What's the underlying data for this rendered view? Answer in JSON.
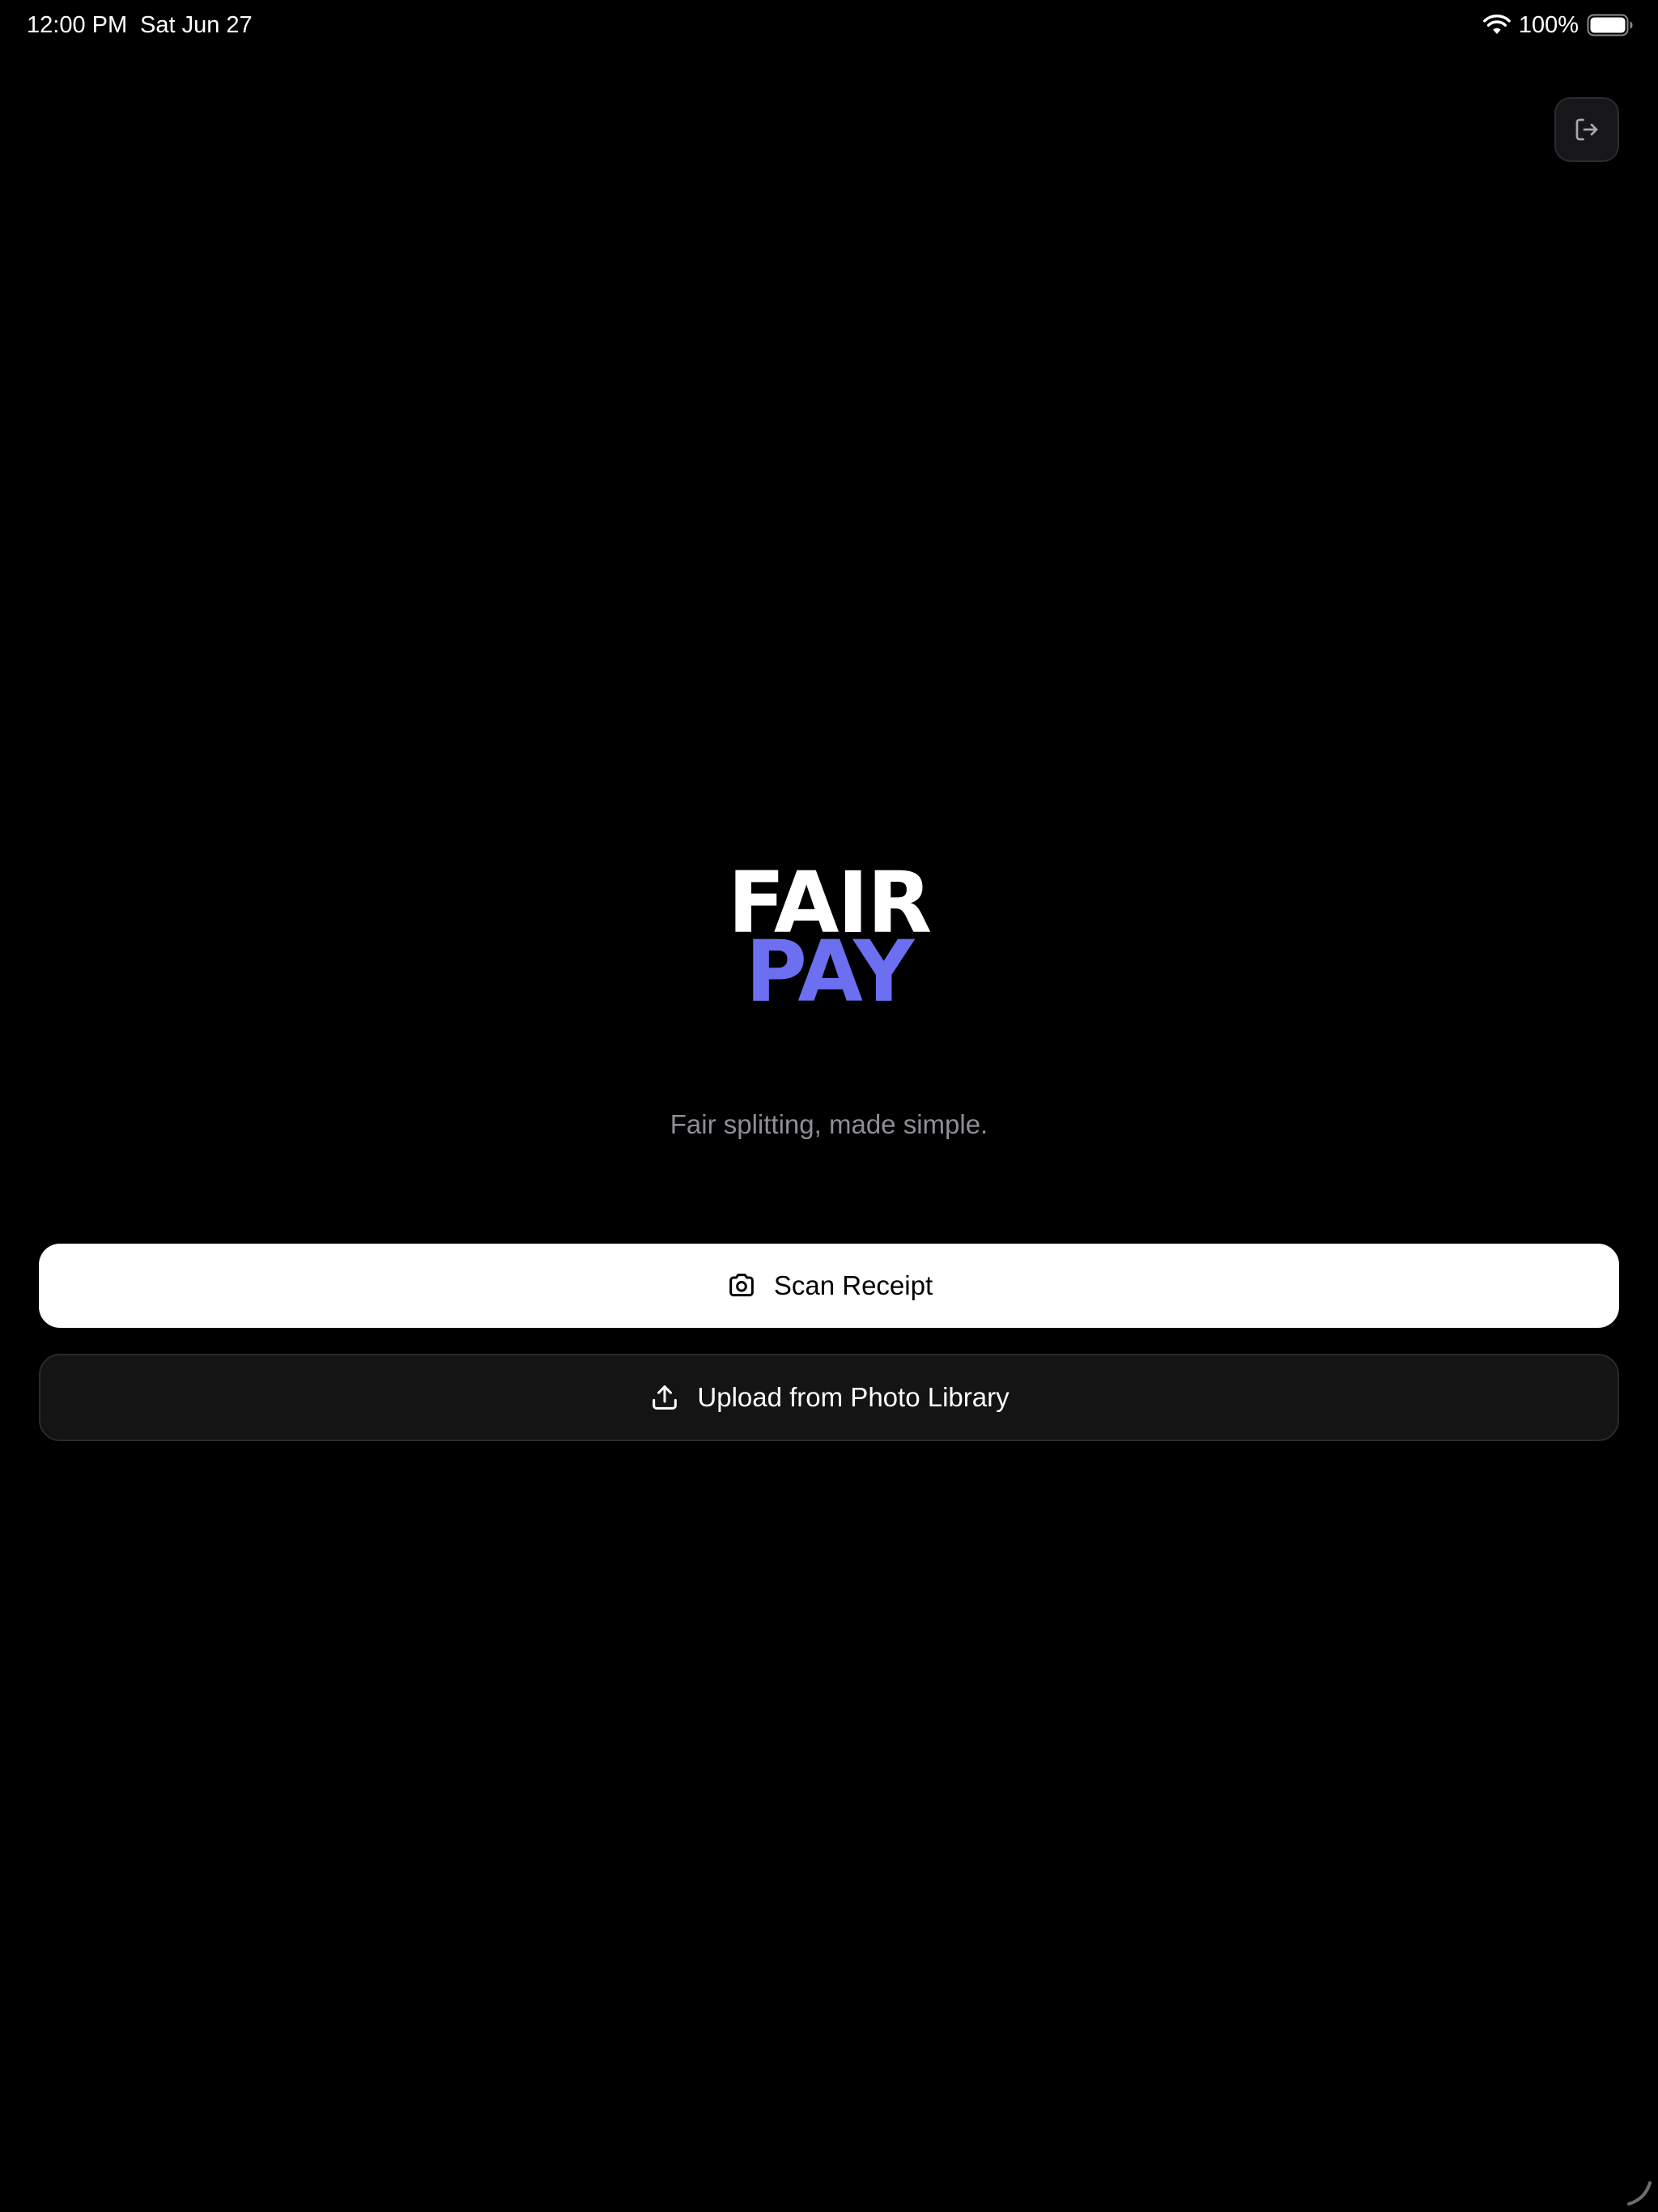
{
  "status_bar": {
    "time": "12:00 PM",
    "date": "Sat Jun 27",
    "battery_percent": "100%",
    "wifi_icon": "wifi-icon",
    "battery_icon": "battery-full-icon"
  },
  "header": {
    "logout_icon": "logout-icon"
  },
  "logo": {
    "line1": "FAIR",
    "line2": "PAY"
  },
  "tagline": "Fair splitting, made simple.",
  "actions": {
    "scan_label": "Scan Receipt",
    "scan_icon": "camera-icon",
    "upload_label": "Upload from Photo Library",
    "upload_icon": "upload-icon"
  },
  "colors": {
    "background": "#000000",
    "logo_primary": "#ffffff",
    "logo_accent": "#6b6ff0",
    "tagline": "#8e8e96",
    "scan_button_bg": "#ffffff",
    "upload_button_bg": "#141414"
  }
}
